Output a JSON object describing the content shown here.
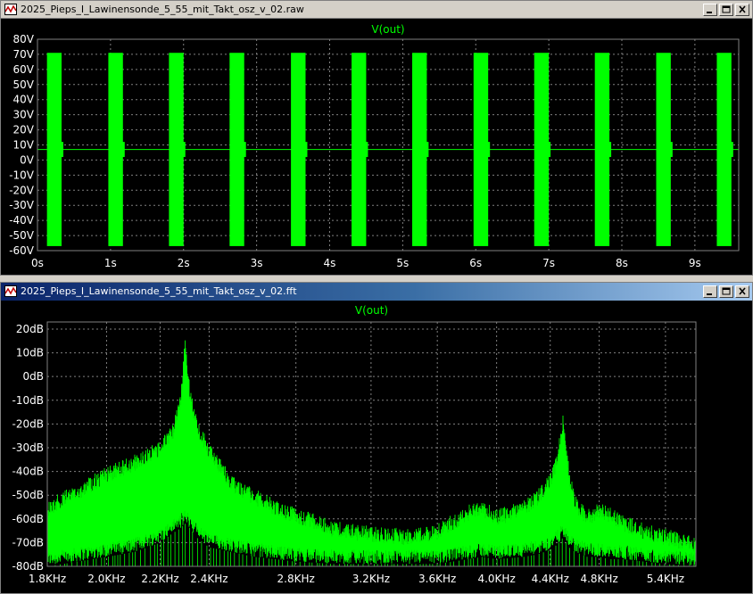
{
  "windows": [
    {
      "title": "2025_Pieps_I_Lawinensonde_5_55_mit_Takt_osz_v_02.raw",
      "active": false,
      "buttons": [
        "minimize",
        "maximize",
        "close"
      ]
    },
    {
      "title": "2025_Pieps_I_Lawinensonde_5_55_mit_Takt_osz_v_02.fft",
      "active": true,
      "buttons": [
        "minimize",
        "maximize",
        "close"
      ]
    }
  ],
  "colors": {
    "trace": "#00ff00",
    "background": "#000000",
    "grid": "#808080",
    "axis_text": "#ffffff",
    "trace_label": "#00ff00"
  },
  "chart_data": [
    {
      "type": "line",
      "title": "",
      "trace_label": "V(out)",
      "xlabel": "",
      "ylabel": "",
      "x_ticks": [
        "0s",
        "1s",
        "2s",
        "3s",
        "4s",
        "5s",
        "6s",
        "7s",
        "8s",
        "9s"
      ],
      "x_tick_values": [
        0,
        1,
        2,
        3,
        4,
        5,
        6,
        7,
        8,
        9
      ],
      "y_ticks": [
        "80V",
        "70V",
        "60V",
        "50V",
        "40V",
        "30V",
        "20V",
        "10V",
        "0V",
        "-10V",
        "-20V",
        "-30V",
        "-40V",
        "-50V",
        "-60V"
      ],
      "y_tick_values": [
        80,
        70,
        60,
        50,
        40,
        30,
        20,
        10,
        0,
        -10,
        -20,
        -30,
        -40,
        -50,
        -60
      ],
      "xlim": [
        0,
        9.6
      ],
      "ylim": [
        -60,
        80
      ],
      "grid": true,
      "series": [
        {
          "bursts_start_s": [
            0.13,
            0.97,
            1.8,
            2.63,
            3.47,
            4.3,
            5.13,
            5.97,
            6.8,
            7.63,
            8.47,
            9.3
          ],
          "burst_length_s": 0.2,
          "burst_max_V": 71,
          "burst_min_V": -57,
          "baseline_V": 7
        }
      ]
    },
    {
      "type": "line",
      "title": "",
      "trace_label": "V(out)",
      "xlabel": "",
      "ylabel": "",
      "x_ticks": [
        "1.8KHz",
        "2.0KHz",
        "2.2KHz",
        "2.4KHz",
        "2.8KHz",
        "3.2KHz",
        "3.6KHz",
        "4.0KHz",
        "4.4KHz",
        "4.8KHz",
        "5.4KHz"
      ],
      "x_tick_values": [
        1.8,
        2.0,
        2.2,
        2.4,
        2.8,
        3.2,
        3.6,
        4.0,
        4.4,
        4.8,
        5.4
      ],
      "y_ticks": [
        "20dB",
        "10dB",
        "0dB",
        "-10dB",
        "-20dB",
        "-30dB",
        "-40dB",
        "-50dB",
        "-60dB",
        "-70dB",
        "-80dB"
      ],
      "y_tick_values": [
        20,
        10,
        0,
        -10,
        -20,
        -30,
        -40,
        -50,
        -60,
        -70,
        -80
      ],
      "x_scale": "log",
      "xlim": [
        1.8,
        5.7
      ],
      "ylim": [
        -80,
        23
      ],
      "grid": true,
      "series": [
        {
          "envelope_x_kHz": [
            1.8,
            1.9,
            2.0,
            2.1,
            2.2,
            2.25,
            2.28,
            2.3,
            2.32,
            2.35,
            2.4,
            2.5,
            2.6,
            2.7,
            2.8,
            3.0,
            3.2,
            3.4,
            3.6,
            3.8,
            3.9,
            4.0,
            4.2,
            4.3,
            4.4,
            4.45,
            4.5,
            4.55,
            4.6,
            4.7,
            4.8,
            4.9,
            5.0,
            5.2,
            5.4,
            5.7
          ],
          "envelope_top_dB": [
            -52,
            -45,
            -38,
            -33,
            -27,
            -20,
            -8,
            18,
            -5,
            -18,
            -28,
            -42,
            -47,
            -52,
            -55,
            -61,
            -63,
            -64,
            -62,
            -54,
            -52,
            -56,
            -52,
            -48,
            -40,
            -33,
            -15,
            -38,
            -50,
            -56,
            -53,
            -55,
            -58,
            -62,
            -64,
            -68
          ],
          "envelope_bottom_dB": [
            -80,
            -78,
            -76,
            -74,
            -70,
            -66,
            -64,
            -62,
            -64,
            -68,
            -72,
            -74,
            -76,
            -77,
            -78,
            -79,
            -79,
            -79,
            -79,
            -77,
            -76,
            -77,
            -76,
            -75,
            -73,
            -71,
            -68,
            -72,
            -74,
            -76,
            -76,
            -77,
            -77,
            -78,
            -79,
            -80
          ]
        }
      ]
    }
  ]
}
